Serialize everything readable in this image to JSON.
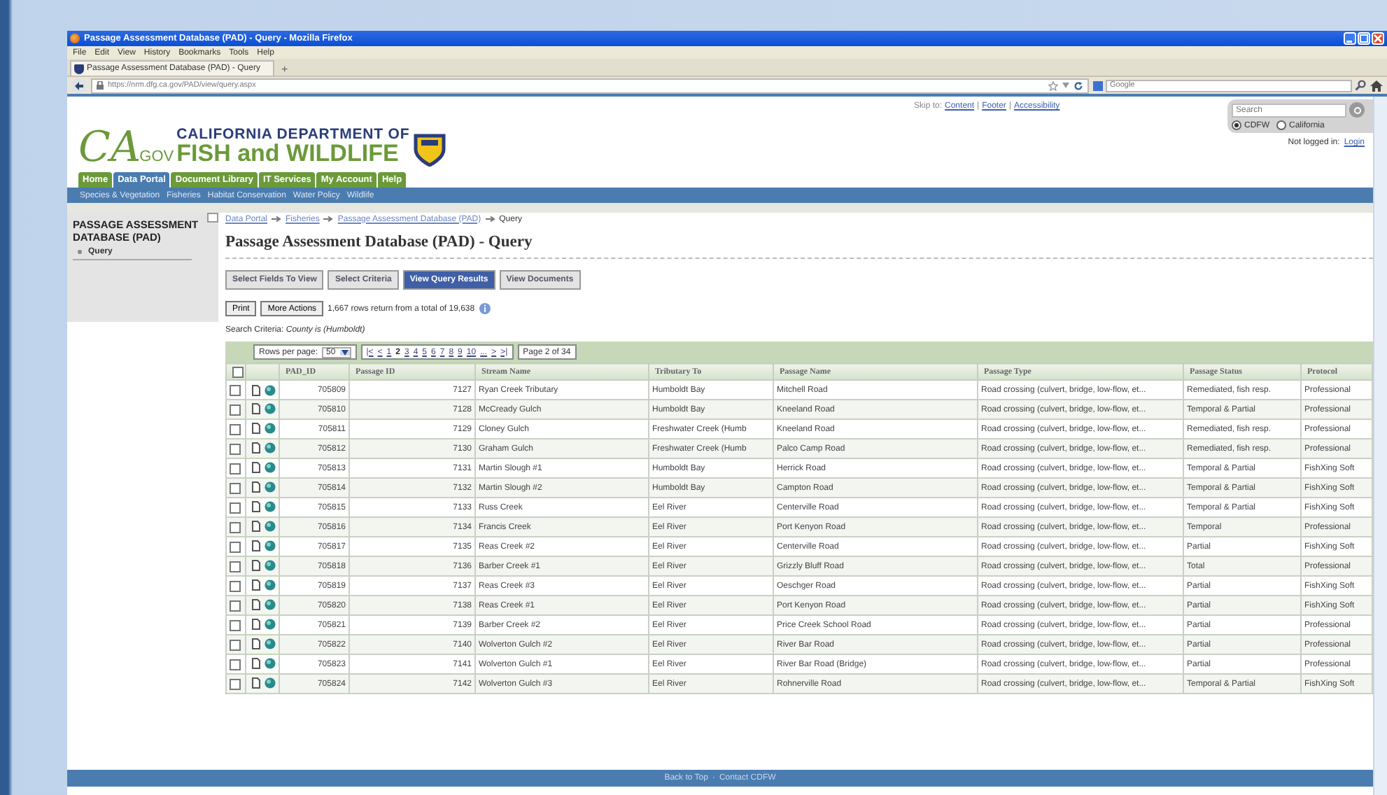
{
  "browser": {
    "title": "Passage Assessment Database (PAD) - Query - Mozilla Firefox",
    "menu": [
      "File",
      "Edit",
      "View",
      "History",
      "Bookmarks",
      "Tools",
      "Help"
    ],
    "tab": "Passage Assessment Database (PAD) - Query",
    "new_tab": "+",
    "url": "https://nrm.dfg.ca.gov/PAD/view/query.aspx",
    "search_placeholder": "Google"
  },
  "header": {
    "logo_ca": "CA",
    "logo_gov": ".GOV",
    "dept_line1": "CALIFORNIA DEPARTMENT OF",
    "dept_line2": "FISH and WILDLIFE",
    "skip_label": "Skip to:",
    "skip_links": [
      "Content",
      "Footer",
      "Accessibility"
    ],
    "skip_separator": "|",
    "site_search_placeholder": "Search",
    "scopes": [
      {
        "label": "CDFW",
        "selected": true
      },
      {
        "label": "California",
        "selected": false
      }
    ],
    "login_status": "Not logged in:",
    "login_link": "Login"
  },
  "nav_tabs": [
    {
      "label": "Home",
      "selected": false
    },
    {
      "label": "Data Portal",
      "selected": true
    },
    {
      "label": "Document Library",
      "selected": false
    },
    {
      "label": "IT Services",
      "selected": false
    },
    {
      "label": "My Account",
      "selected": false
    },
    {
      "label": "Help",
      "selected": false
    }
  ],
  "sub_nav": [
    "Species & Vegetation",
    "Fisheries",
    "Habitat Conservation",
    "Water Policy",
    "Wildlife"
  ],
  "sidebar": {
    "title": "PASSAGE ASSESSMENT DATABASE (PAD)",
    "items": [
      "Query"
    ]
  },
  "breadcrumb": [
    {
      "label": "Data Portal",
      "link": true
    },
    {
      "label": "Fisheries",
      "link": true
    },
    {
      "label": "Passage Assessment Database (PAD)",
      "link": true
    },
    {
      "label": "Query",
      "link": false
    }
  ],
  "page_title": "Passage Assessment Database (PAD) - Query",
  "step_buttons": [
    {
      "label": "Select Fields To View",
      "selected": false
    },
    {
      "label": "Select Criteria",
      "selected": false
    },
    {
      "label": "View Query Results",
      "selected": true
    },
    {
      "label": "View Documents",
      "selected": false
    }
  ],
  "actions": [
    "Print",
    "More Actions"
  ],
  "result_count": "1,667 rows return from a total of 19,638",
  "search_criteria": "Search Criteria: *County is (Humboldt)*",
  "pager": {
    "rows_label": "Rows per page:",
    "rows_value": "50",
    "nav": [
      {
        "label": "|<",
        "selected": false
      },
      {
        "label": "<",
        "selected": false
      },
      {
        "label": "1",
        "selected": false
      },
      {
        "label": "2",
        "selected": true
      },
      {
        "label": "3",
        "selected": false
      },
      {
        "label": "4",
        "selected": false
      },
      {
        "label": "5",
        "selected": false
      },
      {
        "label": "6",
        "selected": false
      },
      {
        "label": "7",
        "selected": false
      },
      {
        "label": "8",
        "selected": false
      },
      {
        "label": "9",
        "selected": false
      },
      {
        "label": "10",
        "selected": false
      },
      {
        "label": "...",
        "selected": false
      },
      {
        "label": ">",
        "selected": false
      },
      {
        "label": ">|",
        "selected": false
      }
    ],
    "page_label": "Page 2 of 34"
  },
  "table": {
    "all_checked": false,
    "columns": [
      "PAD_ID",
      "Passage ID",
      "Stream Name",
      "Tributary To",
      "Passage Name",
      "Passage Type",
      "Passage Status",
      "Protocol"
    ],
    "rows": [
      {
        "checked": false,
        "cells": [
          "705809",
          "7127",
          "Ryan Creek Tributary",
          "Humboldt Bay",
          "Mitchell Road",
          "Road crossing (culvert, bridge, low-flow, et...",
          "Remediated, fish resp.",
          "Professional"
        ]
      },
      {
        "checked": false,
        "cells": [
          "705810",
          "7128",
          "McCready Gulch",
          "Humboldt Bay",
          "Kneeland Road",
          "Road crossing (culvert, bridge, low-flow, et...",
          "Temporal & Partial",
          "Professional"
        ]
      },
      {
        "checked": false,
        "cells": [
          "705811",
          "7129",
          "Cloney Gulch",
          "Freshwater Creek (Humb",
          "Kneeland Road",
          "Road crossing (culvert, bridge, low-flow, et...",
          "Remediated, fish resp.",
          "Professional"
        ]
      },
      {
        "checked": false,
        "cells": [
          "705812",
          "7130",
          "Graham Gulch",
          "Freshwater Creek (Humb",
          "Palco Camp Road",
          "Road crossing (culvert, bridge, low-flow, et...",
          "Remediated, fish resp.",
          "Professional"
        ]
      },
      {
        "checked": false,
        "cells": [
          "705813",
          "7131",
          "Martin Slough #1",
          "Humboldt Bay",
          "Herrick Road",
          "Road crossing (culvert, bridge, low-flow, et...",
          "Temporal & Partial",
          "FishXing Soft"
        ]
      },
      {
        "checked": false,
        "cells": [
          "705814",
          "7132",
          "Martin Slough #2",
          "Humboldt Bay",
          "Campton Road",
          "Road crossing (culvert, bridge, low-flow, et...",
          "Temporal & Partial",
          "FishXing Soft"
        ]
      },
      {
        "checked": false,
        "cells": [
          "705815",
          "7133",
          "Russ Creek",
          "Eel River",
          "Centerville Road",
          "Road crossing (culvert, bridge, low-flow, et...",
          "Temporal & Partial",
          "FishXing Soft"
        ]
      },
      {
        "checked": false,
        "cells": [
          "705816",
          "7134",
          "Francis Creek",
          "Eel River",
          "Port Kenyon Road",
          "Road crossing (culvert, bridge, low-flow, et...",
          "Temporal",
          "Professional"
        ]
      },
      {
        "checked": false,
        "cells": [
          "705817",
          "7135",
          "Reas Creek #2",
          "Eel River",
          "Centerville Road",
          "Road crossing (culvert, bridge, low-flow, et...",
          "Partial",
          "FishXing Soft"
        ]
      },
      {
        "checked": false,
        "cells": [
          "705818",
          "7136",
          "Barber Creek #1",
          "Eel River",
          "Grizzly Bluff Road",
          "Road crossing (culvert, bridge, low-flow, et...",
          "Total",
          "Professional"
        ]
      },
      {
        "checked": false,
        "cells": [
          "705819",
          "7137",
          "Reas Creek #3",
          "Eel River",
          "Oeschger Road",
          "Road crossing (culvert, bridge, low-flow, et...",
          "Partial",
          "FishXing Soft"
        ]
      },
      {
        "checked": false,
        "cells": [
          "705820",
          "7138",
          "Reas Creek #1",
          "Eel River",
          "Port Kenyon Road",
          "Road crossing (culvert, bridge, low-flow, et...",
          "Partial",
          "FishXing Soft"
        ]
      },
      {
        "checked": false,
        "cells": [
          "705821",
          "7139",
          "Barber Creek #2",
          "Eel River",
          "Price Creek School Road",
          "Road crossing (culvert, bridge, low-flow, et...",
          "Partial",
          "Professional"
        ]
      },
      {
        "checked": false,
        "cells": [
          "705822",
          "7140",
          "Wolverton Gulch #2",
          "Eel River",
          "River Bar Road",
          "Road crossing (culvert, bridge, low-flow, et...",
          "Partial",
          "Professional"
        ]
      },
      {
        "checked": false,
        "cells": [
          "705823",
          "7141",
          "Wolverton Gulch #1",
          "Eel River",
          "River Bar Road (Bridge)",
          "Road crossing (culvert, bridge, low-flow, et...",
          "Partial",
          "Professional"
        ]
      },
      {
        "checked": false,
        "cells": [
          "705824",
          "7142",
          "Wolverton Gulch #3",
          "Eel River",
          "Rohnerville Road",
          "Road crossing (culvert, bridge, low-flow, et...",
          "Temporal & Partial",
          "FishXing Soft"
        ]
      }
    ]
  },
  "footer": {
    "links": [
      "Back to Top",
      "Contact CDFW"
    ],
    "separator": "·"
  }
}
